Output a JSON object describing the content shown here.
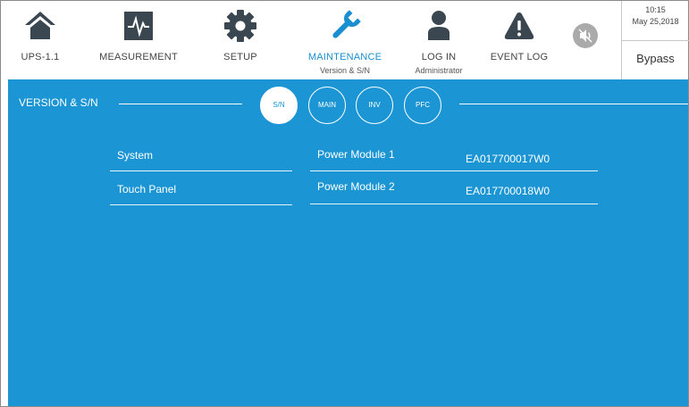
{
  "nav": {
    "ups": {
      "label": "UPS-1.1"
    },
    "measurement": {
      "label": "MEASUREMENT"
    },
    "setup": {
      "label": "SETUP"
    },
    "maintenance": {
      "label": "MAINTENANCE",
      "sub": "Version & S/N"
    },
    "login": {
      "label": "LOG IN",
      "sub": "Administrator"
    },
    "eventlog": {
      "label": "EVENT LOG"
    }
  },
  "status": {
    "time": "10:15",
    "date": "May 25,2018",
    "mode": "Bypass"
  },
  "section": {
    "title": "VERSION & S/N"
  },
  "subtabs": [
    {
      "label": "S/N"
    },
    {
      "label": "MAIN"
    },
    {
      "label": "INV"
    },
    {
      "label": "PFC"
    }
  ],
  "left_rows": [
    {
      "label": "System"
    },
    {
      "label": "Touch Panel"
    }
  ],
  "right_rows": [
    {
      "label": "Power Module 1",
      "value": "EA017700017W0"
    },
    {
      "label": "Power Module 2",
      "value": "EA017700018W0"
    }
  ],
  "colors": {
    "accent": "#1b95d3",
    "icon": "#3a4750",
    "active_label": "#1a8fd0"
  }
}
